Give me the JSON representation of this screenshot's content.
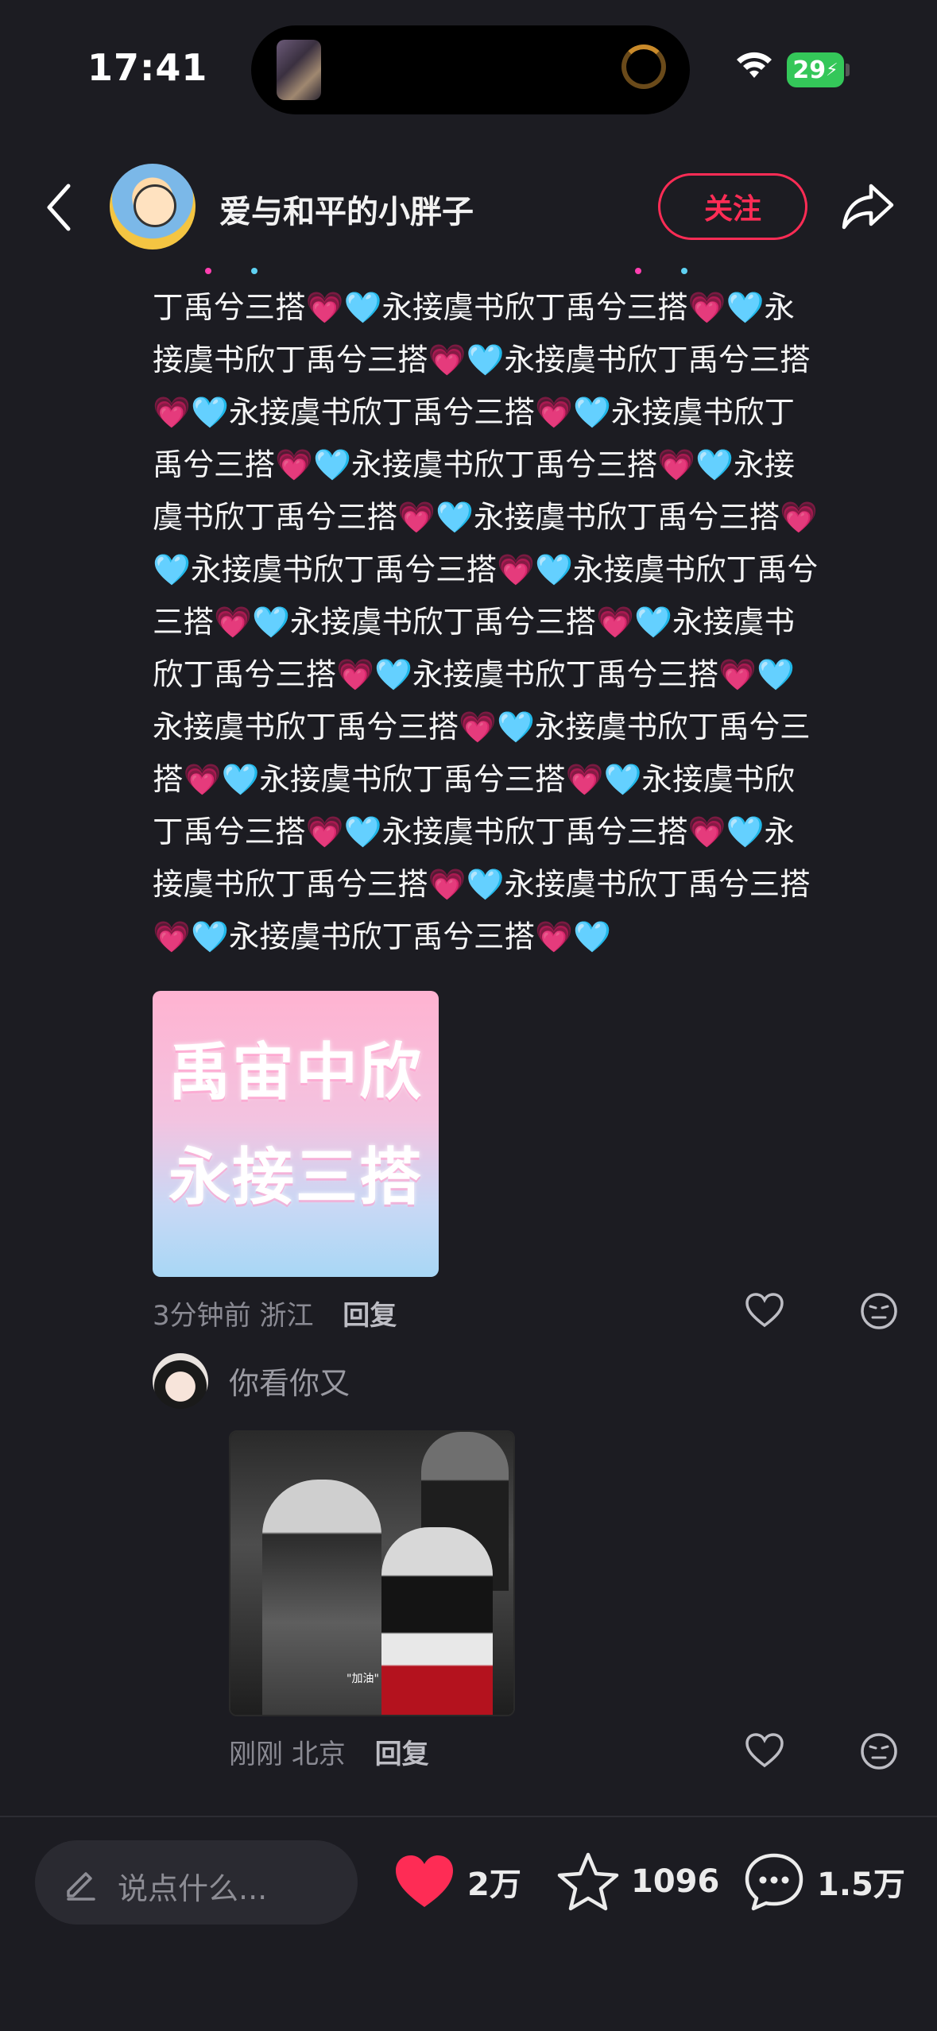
{
  "status_bar": {
    "time": "17:41",
    "battery": "29"
  },
  "header": {
    "author_name": "爱与和平的小胖子",
    "follow_label": "关注"
  },
  "comment": {
    "lines": [
      "丁禹兮三搭💗🩵永接虞书欣丁禹兮三搭💗🩵永",
      "接虞书欣丁禹兮三搭💗🩵永接虞书欣丁禹兮三搭",
      "💗🩵永接虞书欣丁禹兮三搭💗🩵永接虞书欣丁",
      "禹兮三搭💗🩵永接虞书欣丁禹兮三搭💗🩵永接",
      "虞书欣丁禹兮三搭💗🩵永接虞书欣丁禹兮三搭💗",
      "🩵永接虞书欣丁禹兮三搭💗🩵永接虞书欣丁禹兮",
      "三搭💗🩵永接虞书欣丁禹兮三搭💗🩵永接虞书",
      "欣丁禹兮三搭💗🩵永接虞书欣丁禹兮三搭💗🩵",
      "永接虞书欣丁禹兮三搭💗🩵永接虞书欣丁禹兮三",
      "搭💗🩵永接虞书欣丁禹兮三搭💗🩵永接虞书欣",
      "丁禹兮三搭💗🩵永接虞书欣丁禹兮三搭💗🩵永",
      "接虞书欣丁禹兮三搭💗🩵永接虞书欣丁禹兮三搭",
      "💗🩵永接虞书欣丁禹兮三搭💗🩵"
    ],
    "sticker_line1": "禹宙中欣",
    "sticker_line2": "永接三搭",
    "time": "3分钟前",
    "location": "浙江",
    "reply_label": "回复"
  },
  "reply": {
    "username": "你看你又",
    "image_caption": "\"加油\"",
    "time": "刚刚",
    "location": "北京",
    "reply_label": "回复"
  },
  "bottom_bar": {
    "input_placeholder": "说点什么...",
    "like_count": "2万",
    "favorite_count": "1096",
    "comment_count": "1.5万"
  },
  "colors": {
    "background": "#1c1c22",
    "accent_red": "#fe2c55",
    "pink_heart": "#ff3fb0",
    "blue_heart": "#5fd1f2"
  },
  "icons": [
    "back-icon",
    "share-icon",
    "wifi-icon",
    "heart-icon",
    "emoji-icon",
    "pen-icon",
    "star-icon",
    "comment-icon"
  ]
}
